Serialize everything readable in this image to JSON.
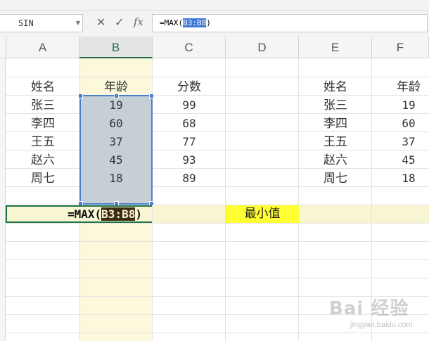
{
  "formula_bar": {
    "name_box": "SIN",
    "cancel_icon": "✕",
    "confirm_icon": "✓",
    "fx_label": "fx",
    "formula_prefix": "=MAX(",
    "formula_ref": "B3:B8",
    "formula_suffix": ")"
  },
  "columns": [
    "A",
    "B",
    "C",
    "D",
    "E",
    "F"
  ],
  "table_left": {
    "headers": [
      "姓名",
      "年龄",
      "分数"
    ],
    "rows": [
      [
        "张三",
        "19",
        "99"
      ],
      [
        "李四",
        "60",
        "68"
      ],
      [
        "王五",
        "37",
        "77"
      ],
      [
        "赵六",
        "45",
        "93"
      ],
      [
        "周七",
        "18",
        "89"
      ]
    ]
  },
  "table_right": {
    "headers": [
      "姓名",
      "年龄"
    ],
    "rows": [
      [
        "张三",
        "19"
      ],
      [
        "李四",
        "60"
      ],
      [
        "王五",
        "37"
      ],
      [
        "赵六",
        "45"
      ],
      [
        "周七",
        "18"
      ]
    ]
  },
  "edit_cell": {
    "prefix": "=MAX(",
    "ref": "B3:B8",
    "suffix": ")"
  },
  "label_cell": "最小值",
  "watermark": {
    "logo": "Bai 经验",
    "url": "jingyan.baidu.com"
  },
  "colors": {
    "selection_fill": "#c6cfd6",
    "selection_border": "#4a7fcf",
    "highlight_yellow": "#ffff33",
    "column_tint": "#fbf8dc"
  }
}
